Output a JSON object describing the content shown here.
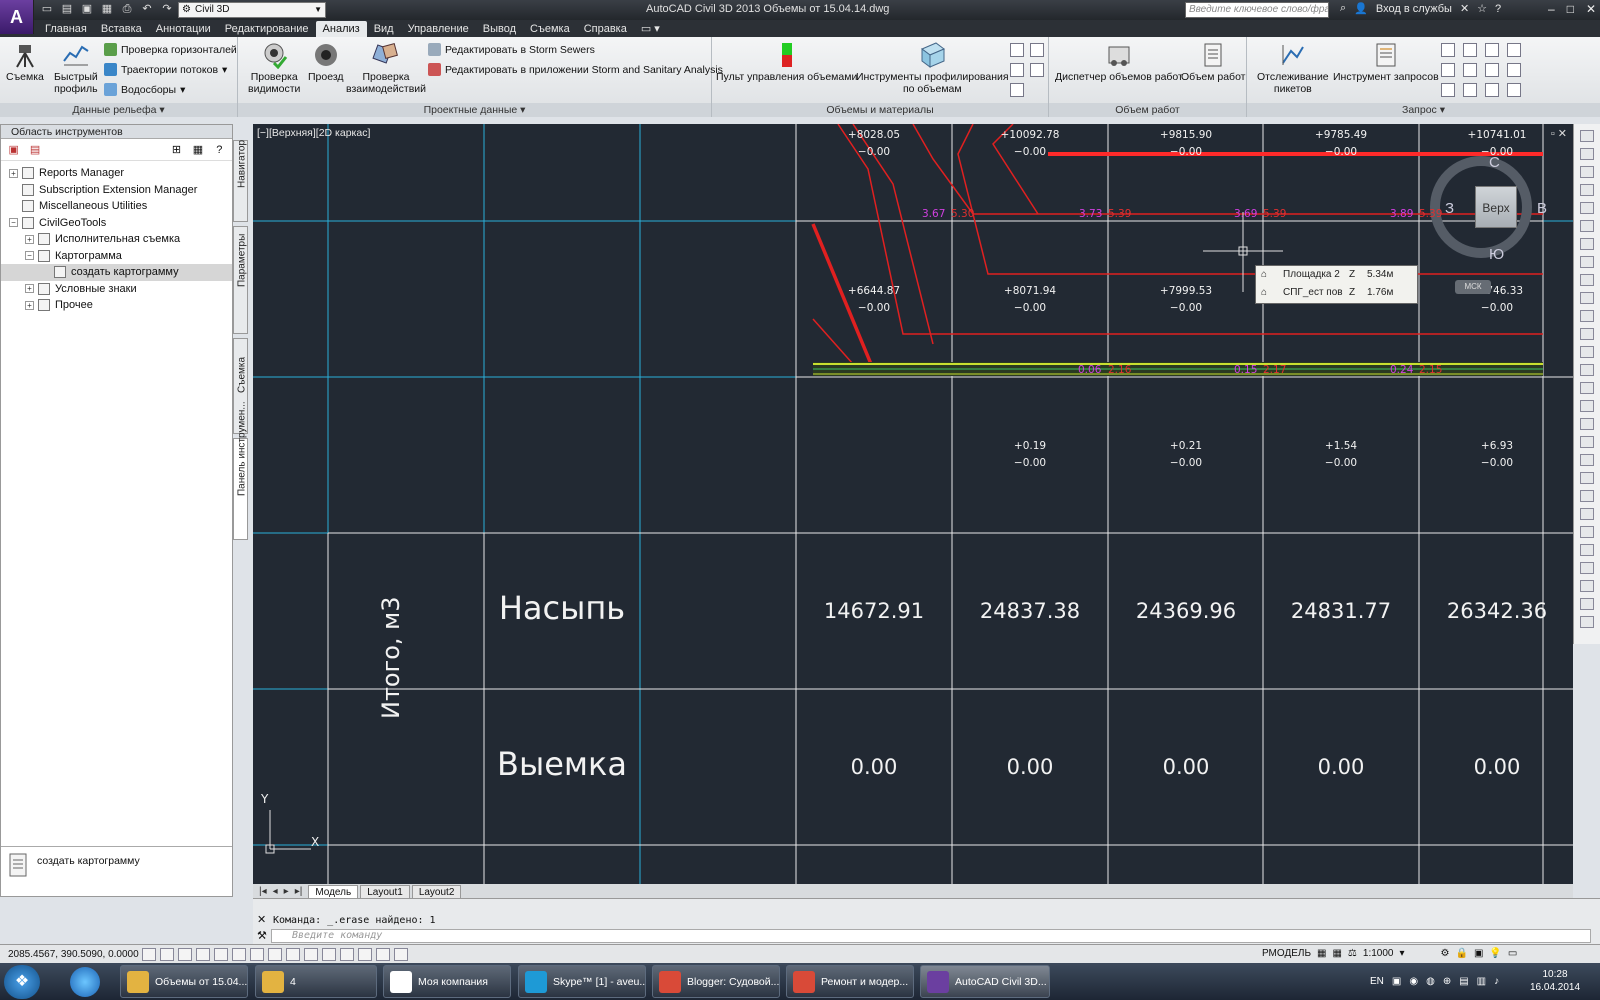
{
  "window": {
    "app_letter": "A",
    "app_sub": "C3D",
    "workspace": "Civil 3D",
    "title": "AutoCAD Civil 3D 2013    Объемы от 15.04.14.dwg",
    "search_placeholder": "Введите ключевое слово/фразу",
    "signin": "Вход в службы"
  },
  "tabs": [
    "Главная",
    "Вставка",
    "Аннотации",
    "Редактирование",
    "Анализ",
    "Вид",
    "Управление",
    "Вывод",
    "Съемка",
    "Справка"
  ],
  "active_tab": "Анализ",
  "ribbon": {
    "panel1": {
      "title": "Данные рельефа",
      "survey": "Съемка",
      "quick_profile_1": "Быстрый",
      "quick_profile_2": "профиль",
      "check_contours": "Проверка горизонталей",
      "flow_paths": "Траектории потоков",
      "catchments": "Водосборы"
    },
    "panel2": {
      "title": "Проектные данные",
      "sight_1": "Проверка",
      "sight_2": "видимости",
      "drive": "Проезд",
      "interf_1": "Проверка",
      "interf_2": "взаимодействий",
      "edit_storm": "Редактировать в Storm Sewers",
      "edit_ssa": "Редактировать в приложении Storm and Sanitary Analysis"
    },
    "panel3": {
      "title": "Объемы и материалы",
      "dashboard": "Пульт управления объемами",
      "grading_1": "Инструменты профилирования",
      "grading_2": "по объемам"
    },
    "panel4": {
      "title": "Объем работ",
      "qto_manager": "Диспетчер объемов работ",
      "qto": "Объем работ"
    },
    "panel5": {
      "title": "Запрос",
      "station_1": "Отслеживание",
      "station_2": "пикетов",
      "inquiry": "Инструмент запросов"
    }
  },
  "palette": {
    "header": "Область инструментов",
    "items": [
      {
        "label": "Reports Manager",
        "level": 0,
        "exp": "+"
      },
      {
        "label": "Subscription Extension Manager",
        "level": 0,
        "exp": ""
      },
      {
        "label": "Miscellaneous Utilities",
        "level": 0,
        "exp": ""
      },
      {
        "label": "CivilGeoTools",
        "level": 0,
        "exp": "−"
      },
      {
        "label": "Исполнительная съемка",
        "level": 1,
        "exp": "+"
      },
      {
        "label": "Картограмма",
        "level": 1,
        "exp": "−"
      },
      {
        "label": "создать картограмму",
        "level": 2,
        "exp": ""
      },
      {
        "label": "Условные знаки",
        "level": 1,
        "exp": "+"
      },
      {
        "label": "Прочее",
        "level": 1,
        "exp": "+"
      }
    ],
    "selected_index": 6,
    "footer_label": "создать картограмму",
    "side_tabs": [
      "Навигатор",
      "Параметры",
      "Съемка",
      "Панель инструмен..."
    ]
  },
  "viewport": {
    "label": "[−][Верхняя][2D каркас]",
    "top_row": [
      {
        "a": "+8028.05",
        "b": "−0.00"
      },
      {
        "a": "+10092.78",
        "b": "−0.00"
      },
      {
        "a": "+9815.90",
        "b": "−0.00"
      },
      {
        "a": "+9785.49",
        "b": "−0.00"
      },
      {
        "a": "+10741.01",
        "b": "−0.00"
      }
    ],
    "mid_row": [
      {
        "a": "+6644.87",
        "b": "−0.00"
      },
      {
        "a": "+8071.94",
        "b": "−0.00"
      },
      {
        "a": "+7999.53",
        "b": "−0.00"
      },
      {
        "a": "+8746.33",
        "b": "−0.00"
      }
    ],
    "low_row": [
      {
        "a": "+0.19",
        "b": "−0.00"
      },
      {
        "a": "+0.21",
        "b": "−0.00"
      },
      {
        "a": "+1.54",
        "b": "−0.00"
      },
      {
        "a": "+6.93",
        "b": "−0.00"
      }
    ],
    "labels_magenta": [
      "3.67",
      "3.73",
      "3.69",
      "3.89"
    ],
    "labels_red": [
      "5.30",
      "5.39",
      "5.39",
      "5.39"
    ],
    "labels_magenta2": [
      "0.06",
      "0.15",
      "0.24"
    ],
    "labels_red2": [
      "2.16",
      "2.17",
      "2.15"
    ],
    "row_fill": "Насыпь",
    "row_cut": "Выемка",
    "fill_values": [
      "14672.91",
      "24837.38",
      "24369.96",
      "24831.77",
      "26342.36"
    ],
    "cut_values": [
      "0.00",
      "0.00",
      "0.00",
      "0.00",
      "0.00"
    ],
    "total_label": "Итого, м3",
    "tooltip": [
      {
        "name": "Площадка 2",
        "axis": "Z",
        "value": "5.34м"
      },
      {
        "name": "СПГ_ест пов",
        "axis": "Z",
        "value": "1.76м"
      }
    ],
    "viewcube": {
      "face": "Верх",
      "n": "С",
      "s": "Ю",
      "e": "В",
      "w": "З",
      "ucs": "МСК"
    },
    "axis_y": "Y",
    "axis_x": "X"
  },
  "layout_tabs": [
    "Модель",
    "Layout1",
    "Layout2"
  ],
  "command": {
    "history": "Команда: _.erase найдено: 1",
    "placeholder": "Введите команду"
  },
  "status": {
    "coords": "2085.4567, 390.5090, 0.0000",
    "model": "РМОДЕЛЬ",
    "scale": "1:1000"
  },
  "taskbar": {
    "items": [
      {
        "label": "Объемы от 15.04...",
        "color": "#e3b341"
      },
      {
        "label": "4",
        "color": "#e3b341"
      },
      {
        "label": "Моя компания",
        "color": "#ffffff"
      },
      {
        "label": "Skype™ [1] - aveu...",
        "color": "#1e9ad6"
      },
      {
        "label": "Blogger: Судовой...",
        "color": "#d94a38"
      },
      {
        "label": "Ремонт и модер...",
        "color": "#d94a38"
      },
      {
        "label": "AutoCAD Civil 3D...",
        "color": "#6b3fa0"
      }
    ],
    "lang": "EN",
    "time": "10:28",
    "date": "16.04.2014"
  }
}
